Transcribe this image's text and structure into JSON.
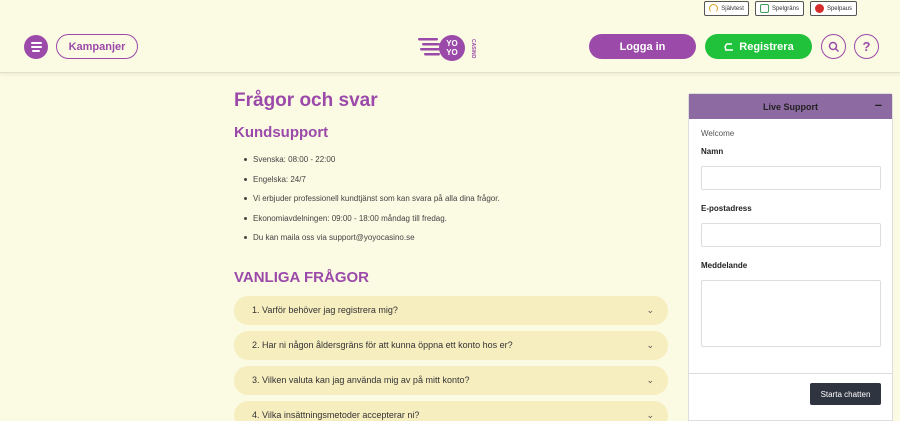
{
  "badges": [
    {
      "label": "Självtest",
      "icon": "gauge-icon",
      "color": "#e0a020"
    },
    {
      "label": "Spelgräns",
      "icon": "limit-icon",
      "color": "#3aa05a"
    },
    {
      "label": "Spelpaus",
      "icon": "pause-icon",
      "color": "#d62b2b"
    }
  ],
  "header": {
    "campaigns_label": "Kampanjer",
    "login_label": "Logga in",
    "register_label": "Registrera",
    "help_label": "?"
  },
  "logo": {
    "text_yo1": "YO",
    "text_yo2": "YO",
    "text_casino": "CASINO"
  },
  "main": {
    "title": "Frågor och svar",
    "support_heading": "Kundsupport",
    "support_items": [
      "Svenska: 08:00 - 22:00",
      "Engelska: 24/7",
      "Vi erbjuder professionell kundtjänst som kan svara på alla dina frågor.",
      "Ekonomiavdelningen: 09:00 - 18:00 måndag till fredag.",
      "Du kan maila oss via support@yoyocasino.se"
    ],
    "faq_heading": "VANLIGA FRÅGOR",
    "faq_items": [
      "1. Varför behöver jag registrera mig?",
      "2. Har ni någon åldersgräns för att kunna öppna ett konto hos er?",
      "3. Vilken valuta kan jag använda mig av på mitt konto?",
      "4. Vilka insättningsmetoder accepterar ni?"
    ]
  },
  "live_support": {
    "title": "Live Support",
    "minimize": "–",
    "welcome": "Welcome",
    "name_label": "Namn",
    "email_label": "E-postadress",
    "message_label": "Meddelande",
    "start_chat_label": "Starta chatten"
  },
  "colors": {
    "brand": "#9b4aa9",
    "register": "#1fc23a",
    "background": "#fbfae3",
    "faq_bg": "#f7eec0"
  }
}
